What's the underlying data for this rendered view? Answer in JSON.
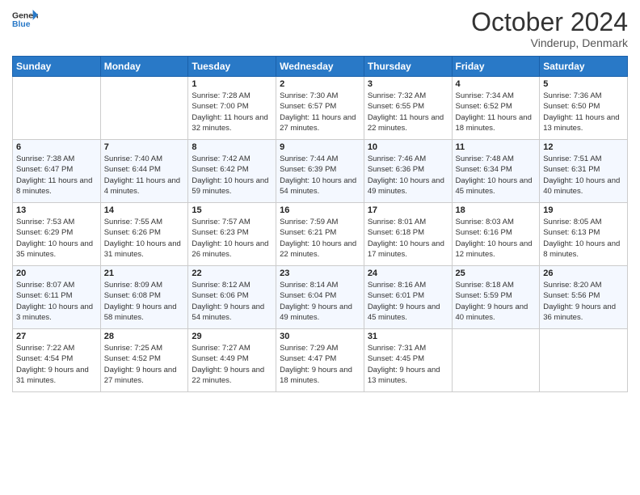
{
  "header": {
    "logo_general": "General",
    "logo_blue": "Blue",
    "month": "October 2024",
    "location": "Vinderup, Denmark"
  },
  "columns": [
    "Sunday",
    "Monday",
    "Tuesday",
    "Wednesday",
    "Thursday",
    "Friday",
    "Saturday"
  ],
  "weeks": [
    [
      {
        "day": "",
        "info": ""
      },
      {
        "day": "",
        "info": ""
      },
      {
        "day": "1",
        "info": "Sunrise: 7:28 AM\nSunset: 7:00 PM\nDaylight: 11 hours and 32 minutes."
      },
      {
        "day": "2",
        "info": "Sunrise: 7:30 AM\nSunset: 6:57 PM\nDaylight: 11 hours and 27 minutes."
      },
      {
        "day": "3",
        "info": "Sunrise: 7:32 AM\nSunset: 6:55 PM\nDaylight: 11 hours and 22 minutes."
      },
      {
        "day": "4",
        "info": "Sunrise: 7:34 AM\nSunset: 6:52 PM\nDaylight: 11 hours and 18 minutes."
      },
      {
        "day": "5",
        "info": "Sunrise: 7:36 AM\nSunset: 6:50 PM\nDaylight: 11 hours and 13 minutes."
      }
    ],
    [
      {
        "day": "6",
        "info": "Sunrise: 7:38 AM\nSunset: 6:47 PM\nDaylight: 11 hours and 8 minutes."
      },
      {
        "day": "7",
        "info": "Sunrise: 7:40 AM\nSunset: 6:44 PM\nDaylight: 11 hours and 4 minutes."
      },
      {
        "day": "8",
        "info": "Sunrise: 7:42 AM\nSunset: 6:42 PM\nDaylight: 10 hours and 59 minutes."
      },
      {
        "day": "9",
        "info": "Sunrise: 7:44 AM\nSunset: 6:39 PM\nDaylight: 10 hours and 54 minutes."
      },
      {
        "day": "10",
        "info": "Sunrise: 7:46 AM\nSunset: 6:36 PM\nDaylight: 10 hours and 49 minutes."
      },
      {
        "day": "11",
        "info": "Sunrise: 7:48 AM\nSunset: 6:34 PM\nDaylight: 10 hours and 45 minutes."
      },
      {
        "day": "12",
        "info": "Sunrise: 7:51 AM\nSunset: 6:31 PM\nDaylight: 10 hours and 40 minutes."
      }
    ],
    [
      {
        "day": "13",
        "info": "Sunrise: 7:53 AM\nSunset: 6:29 PM\nDaylight: 10 hours and 35 minutes."
      },
      {
        "day": "14",
        "info": "Sunrise: 7:55 AM\nSunset: 6:26 PM\nDaylight: 10 hours and 31 minutes."
      },
      {
        "day": "15",
        "info": "Sunrise: 7:57 AM\nSunset: 6:23 PM\nDaylight: 10 hours and 26 minutes."
      },
      {
        "day": "16",
        "info": "Sunrise: 7:59 AM\nSunset: 6:21 PM\nDaylight: 10 hours and 22 minutes."
      },
      {
        "day": "17",
        "info": "Sunrise: 8:01 AM\nSunset: 6:18 PM\nDaylight: 10 hours and 17 minutes."
      },
      {
        "day": "18",
        "info": "Sunrise: 8:03 AM\nSunset: 6:16 PM\nDaylight: 10 hours and 12 minutes."
      },
      {
        "day": "19",
        "info": "Sunrise: 8:05 AM\nSunset: 6:13 PM\nDaylight: 10 hours and 8 minutes."
      }
    ],
    [
      {
        "day": "20",
        "info": "Sunrise: 8:07 AM\nSunset: 6:11 PM\nDaylight: 10 hours and 3 minutes."
      },
      {
        "day": "21",
        "info": "Sunrise: 8:09 AM\nSunset: 6:08 PM\nDaylight: 9 hours and 58 minutes."
      },
      {
        "day": "22",
        "info": "Sunrise: 8:12 AM\nSunset: 6:06 PM\nDaylight: 9 hours and 54 minutes."
      },
      {
        "day": "23",
        "info": "Sunrise: 8:14 AM\nSunset: 6:04 PM\nDaylight: 9 hours and 49 minutes."
      },
      {
        "day": "24",
        "info": "Sunrise: 8:16 AM\nSunset: 6:01 PM\nDaylight: 9 hours and 45 minutes."
      },
      {
        "day": "25",
        "info": "Sunrise: 8:18 AM\nSunset: 5:59 PM\nDaylight: 9 hours and 40 minutes."
      },
      {
        "day": "26",
        "info": "Sunrise: 8:20 AM\nSunset: 5:56 PM\nDaylight: 9 hours and 36 minutes."
      }
    ],
    [
      {
        "day": "27",
        "info": "Sunrise: 7:22 AM\nSunset: 4:54 PM\nDaylight: 9 hours and 31 minutes."
      },
      {
        "day": "28",
        "info": "Sunrise: 7:25 AM\nSunset: 4:52 PM\nDaylight: 9 hours and 27 minutes."
      },
      {
        "day": "29",
        "info": "Sunrise: 7:27 AM\nSunset: 4:49 PM\nDaylight: 9 hours and 22 minutes."
      },
      {
        "day": "30",
        "info": "Sunrise: 7:29 AM\nSunset: 4:47 PM\nDaylight: 9 hours and 18 minutes."
      },
      {
        "day": "31",
        "info": "Sunrise: 7:31 AM\nSunset: 4:45 PM\nDaylight: 9 hours and 13 minutes."
      },
      {
        "day": "",
        "info": ""
      },
      {
        "day": "",
        "info": ""
      }
    ]
  ]
}
